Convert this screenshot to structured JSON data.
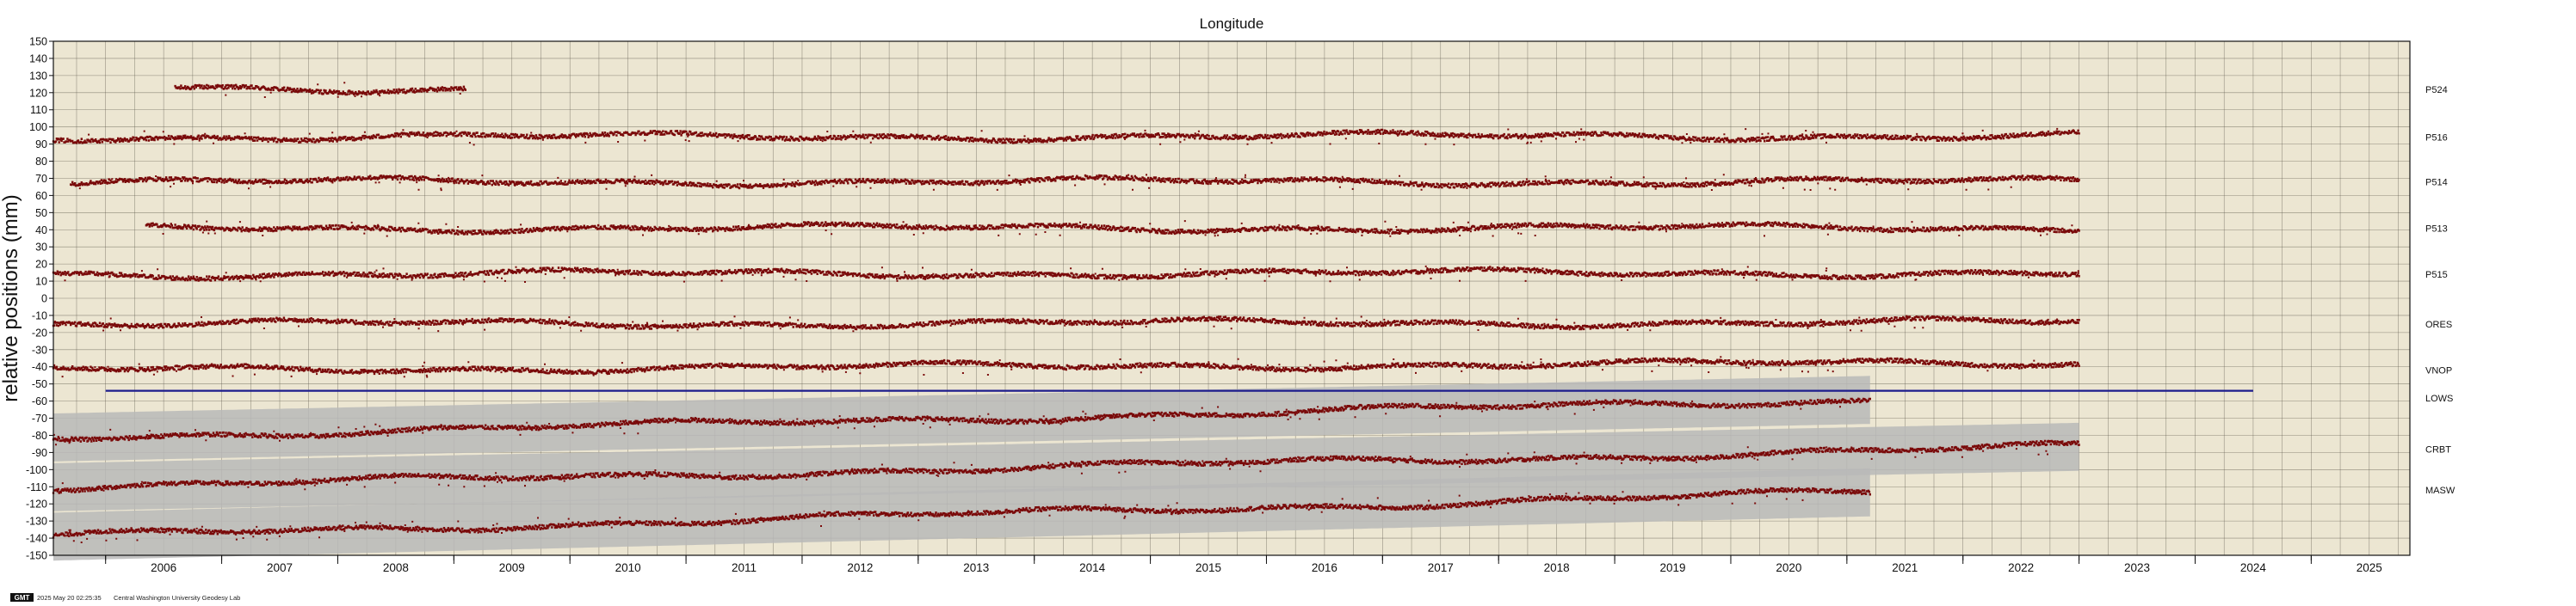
{
  "chart_data": {
    "type": "scatter",
    "title": "Longitude",
    "ylabel": "relative positions (mm)",
    "xlabel": "",
    "xlim": [
      2005.55,
      2025.85
    ],
    "ylim": [
      -150,
      150
    ],
    "x_ticks": [
      "2006",
      "2007",
      "2008",
      "2009",
      "2010",
      "2011",
      "2012",
      "2013",
      "2014",
      "2015",
      "2016",
      "2017",
      "2018",
      "2019",
      "2020",
      "2021",
      "2022",
      "2023",
      "2024",
      "2025"
    ],
    "y_ticks": [
      150,
      140,
      130,
      120,
      110,
      100,
      90,
      80,
      70,
      60,
      50,
      40,
      30,
      20,
      10,
      0,
      -10,
      -20,
      -30,
      -40,
      -50,
      -60,
      -70,
      -80,
      -90,
      -100,
      -110,
      -120,
      -130,
      -140,
      -150
    ],
    "grid": true,
    "background_color": "#ece6d2",
    "point_color": "#7a0a0a",
    "error_band_color": "#b9b9b9",
    "reference_line": {
      "y": -54,
      "x_start": 2006.0,
      "x_end": 2024.5,
      "color": "#1c1c8c"
    },
    "series": [
      {
        "name": "P524",
        "x_start": 2006.6,
        "x_end": 2009.1,
        "baseline": 122,
        "drift_per_year": 0.2,
        "band": 0
      },
      {
        "name": "P516",
        "x_start": 2005.25,
        "x_end": 2023.0,
        "baseline": 94,
        "drift_per_year": 0.05,
        "band": 0
      },
      {
        "name": "P514",
        "x_start": 2005.7,
        "x_end": 2023.0,
        "baseline": 68,
        "drift_per_year": 0.0,
        "band": 0
      },
      {
        "name": "P513",
        "x_start": 2006.35,
        "x_end": 2023.0,
        "baseline": 41,
        "drift_per_year": 0.0,
        "band": 0
      },
      {
        "name": "P515",
        "x_start": 2005.5,
        "x_end": 2023.0,
        "baseline": 14,
        "drift_per_year": 0.05,
        "band": 0
      },
      {
        "name": "ORES",
        "x_start": 2005.1,
        "x_end": 2023.0,
        "baseline": -15,
        "drift_per_year": 0.05,
        "band": 0
      },
      {
        "name": "VNOP",
        "x_start": 2005.1,
        "x_end": 2023.0,
        "baseline": -42,
        "drift_per_year": 0.25,
        "band": 0
      },
      {
        "name": "LOWS",
        "x_start": 2005.0,
        "x_end": 2021.2,
        "baseline": -82,
        "drift_per_year": 1.4,
        "band": 14
      },
      {
        "name": "CRBT",
        "x_start": 2005.0,
        "x_end": 2023.0,
        "baseline": -111,
        "drift_per_year": 1.35,
        "band": 14
      },
      {
        "name": "MASW",
        "x_start": 2005.0,
        "x_end": 2021.2,
        "baseline": -140,
        "drift_per_year": 1.65,
        "band": 14
      }
    ]
  },
  "footer": {
    "badge": "GMT",
    "timestamp": "2025 May 20 02:25:35",
    "credit": "Central Washington University Geodesy Lab"
  }
}
